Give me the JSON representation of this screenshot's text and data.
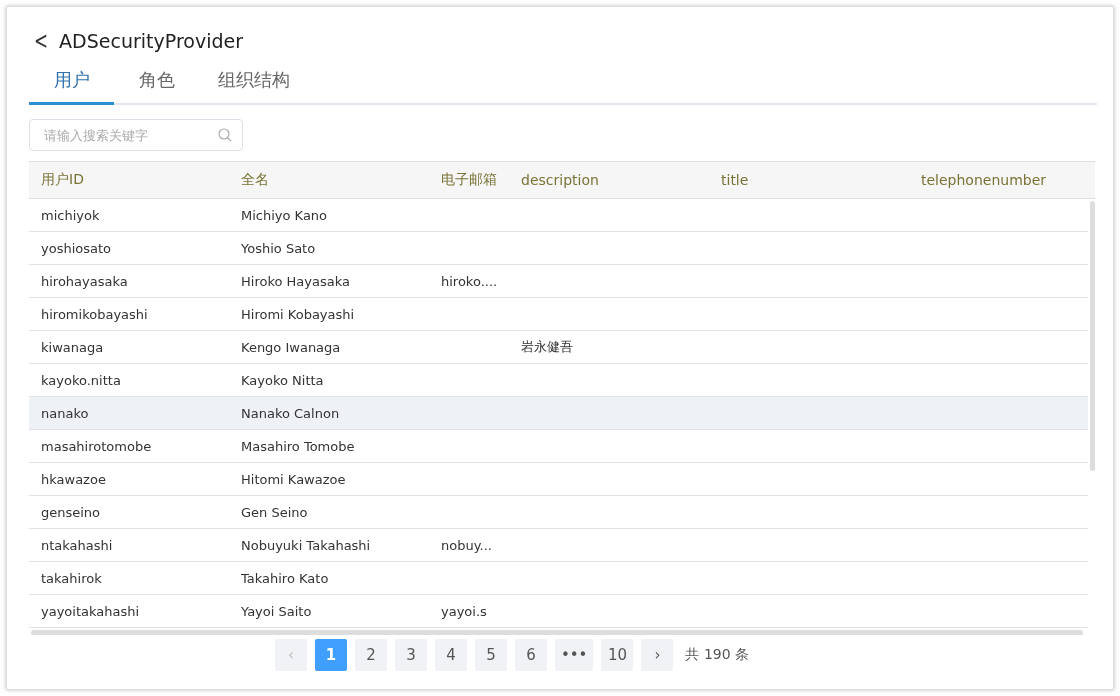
{
  "header": {
    "back": "<",
    "title": "ADSecurityProvider"
  },
  "tabs": [
    {
      "label": "用户",
      "selected": true
    },
    {
      "label": "角色",
      "selected": false
    },
    {
      "label": "组织结构",
      "selected": false
    }
  ],
  "search": {
    "placeholder": "请输入搜索关键字"
  },
  "table": {
    "columns": [
      "用户ID",
      "全名",
      "电子邮箱",
      "description",
      "title",
      "telephonenumber"
    ],
    "rows": [
      {
        "cells": [
          "michiyok",
          "Michiyo Kano",
          "",
          "",
          "",
          ""
        ],
        "highlighted": false
      },
      {
        "cells": [
          "yoshiosato",
          "Yoshio Sato",
          "",
          "",
          "",
          ""
        ],
        "highlighted": false
      },
      {
        "cells": [
          "hirohayasaka",
          "Hiroko Hayasaka",
          "hiroko....",
          "",
          "",
          ""
        ],
        "highlighted": false
      },
      {
        "cells": [
          "hiromikobayashi",
          "Hiromi Kobayashi",
          "",
          "",
          "",
          ""
        ],
        "highlighted": false
      },
      {
        "cells": [
          "kiwanaga",
          "Kengo Iwanaga",
          "",
          "岩永健吾",
          "",
          ""
        ],
        "highlighted": false
      },
      {
        "cells": [
          "kayoko.nitta",
          "Kayoko Nitta",
          "",
          "",
          "",
          ""
        ],
        "highlighted": false
      },
      {
        "cells": [
          "nanako",
          "Nanako Calnon",
          "",
          "",
          "",
          ""
        ],
        "highlighted": true
      },
      {
        "cells": [
          "masahirotomobe",
          "Masahiro Tomobe",
          "",
          "",
          "",
          ""
        ],
        "highlighted": false
      },
      {
        "cells": [
          "hkawazoe",
          "Hitomi Kawazoe",
          "",
          "",
          "",
          ""
        ],
        "highlighted": false
      },
      {
        "cells": [
          "genseino",
          "Gen Seino",
          "",
          "",
          "",
          ""
        ],
        "highlighted": false
      },
      {
        "cells": [
          "ntakahashi",
          "Nobuyuki Takahashi",
          "nobuy...",
          "",
          "",
          ""
        ],
        "highlighted": false
      },
      {
        "cells": [
          "takahirok",
          "Takahiro Kato",
          "",
          "",
          "",
          ""
        ],
        "highlighted": false
      },
      {
        "cells": [
          "yayoitakahashi",
          "Yayoi Saito",
          "yayoi.s",
          "",
          "",
          ""
        ],
        "highlighted": false
      }
    ]
  },
  "pagination": {
    "prev": "‹",
    "pages": [
      {
        "label": "1",
        "selected": true
      },
      {
        "label": "2",
        "selected": false
      },
      {
        "label": "3",
        "selected": false
      },
      {
        "label": "4",
        "selected": false
      },
      {
        "label": "5",
        "selected": false
      },
      {
        "label": "6",
        "selected": false
      },
      {
        "label": "•••",
        "selected": false
      },
      {
        "label": "10",
        "selected": false
      }
    ],
    "next": "›",
    "total": "共 190 条"
  }
}
